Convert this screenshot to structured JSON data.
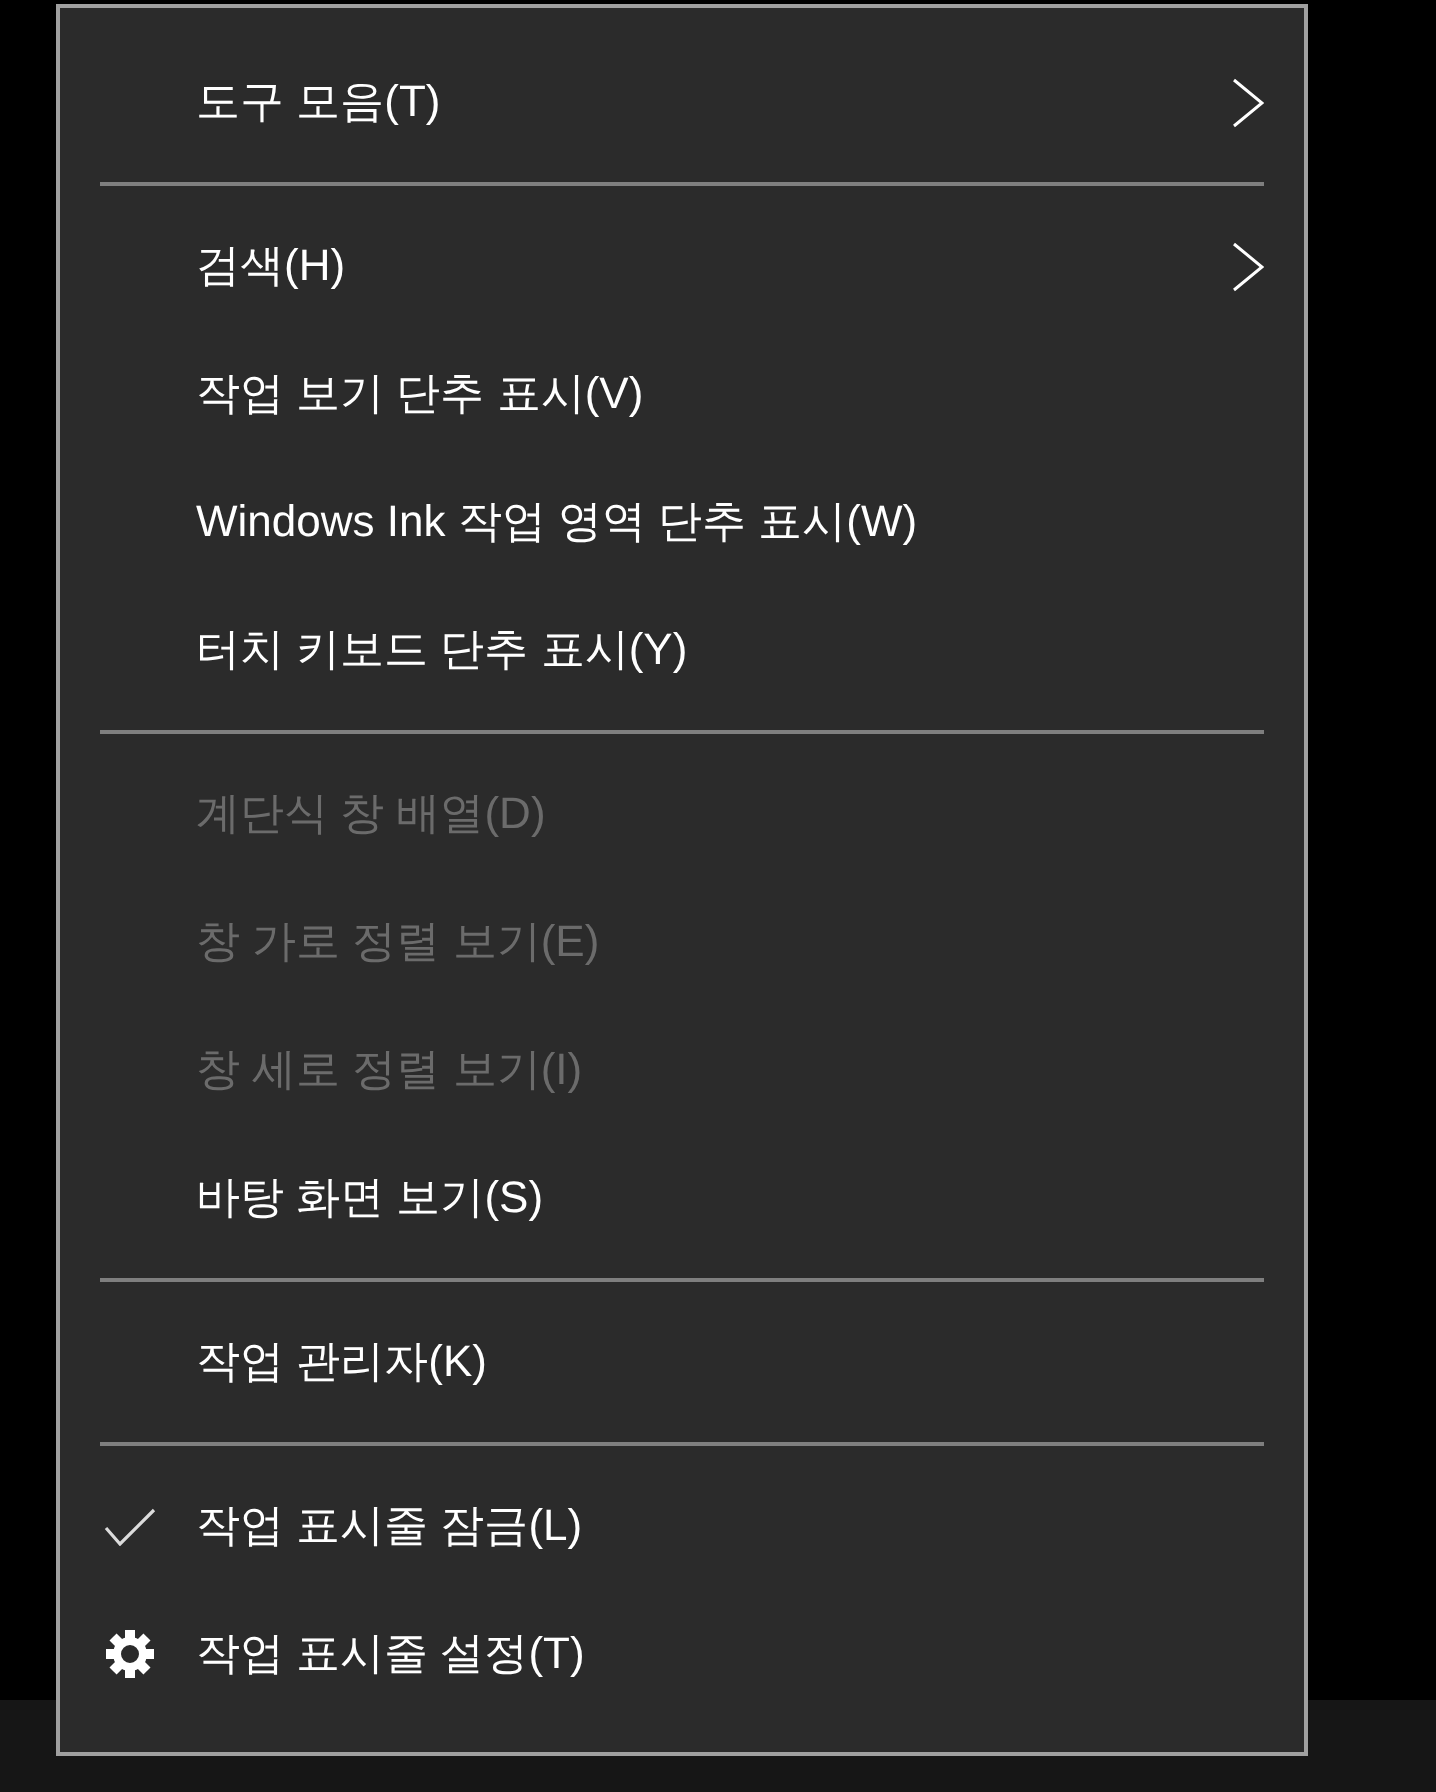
{
  "context_menu": {
    "items": [
      {
        "kind": "submenu",
        "label": "도구 모음(T)",
        "disabled": false
      },
      {
        "kind": "separator"
      },
      {
        "kind": "submenu",
        "label": "검색(H)",
        "disabled": false
      },
      {
        "kind": "command",
        "label": "작업 보기 단추 표시(V)",
        "disabled": false
      },
      {
        "kind": "command",
        "label": "Windows Ink 작업 영역 단추 표시(W)",
        "disabled": false
      },
      {
        "kind": "command",
        "label": "터치 키보드 단추 표시(Y)",
        "disabled": false
      },
      {
        "kind": "separator"
      },
      {
        "kind": "command",
        "label": "계단식 창 배열(D)",
        "disabled": true
      },
      {
        "kind": "command",
        "label": "창 가로 정렬 보기(E)",
        "disabled": true
      },
      {
        "kind": "command",
        "label": "창 세로 정렬 보기(I)",
        "disabled": true
      },
      {
        "kind": "command",
        "label": "바탕 화면 보기(S)",
        "disabled": false
      },
      {
        "kind": "separator"
      },
      {
        "kind": "command",
        "label": "작업 관리자(K)",
        "disabled": false
      },
      {
        "kind": "separator"
      },
      {
        "kind": "toggle",
        "label": "작업 표시줄 잠금(L)",
        "disabled": false,
        "checked": true
      },
      {
        "kind": "settings",
        "label": "작업 표시줄 설정(T)",
        "disabled": false
      }
    ]
  }
}
